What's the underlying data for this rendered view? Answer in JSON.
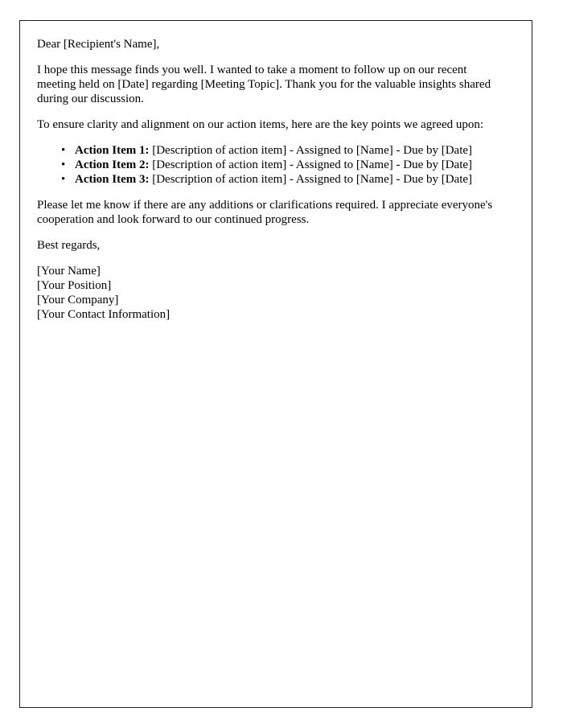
{
  "document": {
    "salutation": "Dear [Recipient's Name],",
    "paragraph_1": "I hope this message finds you well. I wanted to take a moment to follow up on our recent meeting held on [Date] regarding [Meeting Topic]. Thank you for the valuable insights shared during our discussion.",
    "paragraph_2": "To ensure clarity and alignment on our action items, here are the key points we agreed upon:",
    "action_items": [
      {
        "label": "Action Item 1:",
        "text": " [Description of action item] - Assigned to [Name] - Due by [Date]"
      },
      {
        "label": "Action Item 2:",
        "text": " [Description of action item] - Assigned to [Name] - Due by [Date]"
      },
      {
        "label": "Action Item 3:",
        "text": " [Description of action item] - Assigned to [Name] - Due by [Date]"
      }
    ],
    "paragraph_3": "Please let me know if there are any additions or clarifications required. I appreciate everyone's cooperation and look forward to our continued progress.",
    "closing": "Best regards,",
    "signature": [
      "[Your Name]",
      "[Your Position]",
      "[Your Company]",
      "[Your Contact Information]"
    ]
  }
}
